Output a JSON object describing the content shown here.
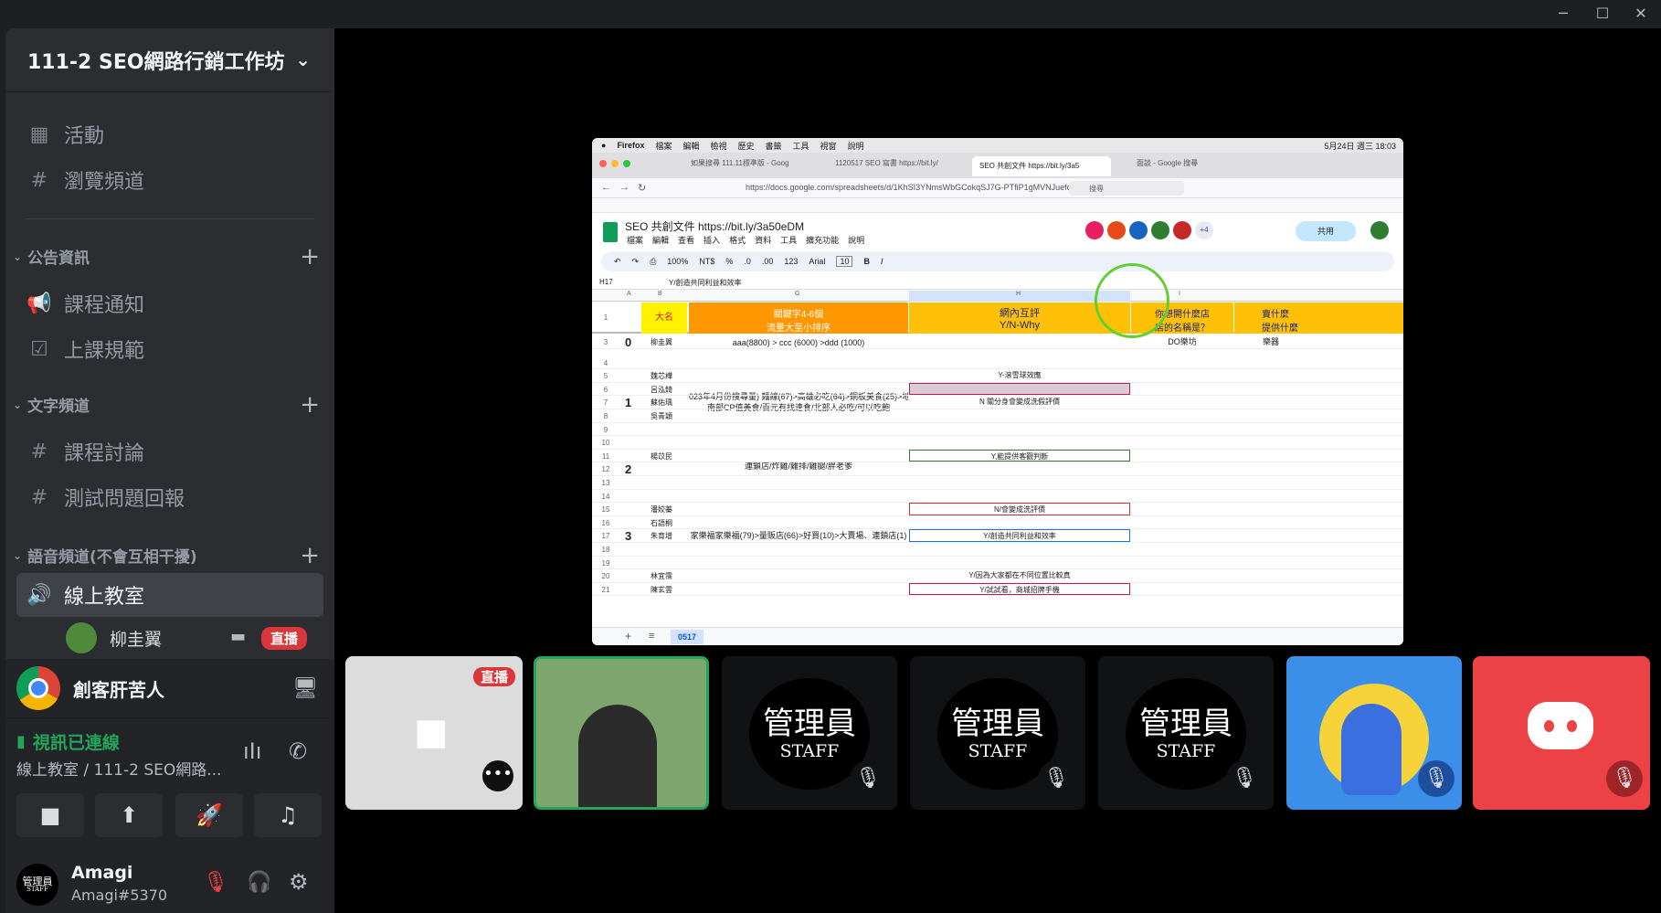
{
  "server": {
    "name": "111-2 SEO網路行銷工作坊"
  },
  "nav": {
    "events": "活動",
    "browse": "瀏覽頻道"
  },
  "categories": {
    "announce": "公告資訊",
    "text": "文字頻道",
    "voice": "語音頻道(不會互相干擾)"
  },
  "channels": {
    "course_notice": "課程通知",
    "class_rules": "上課規範",
    "course_discussion": "課程討論",
    "test_report": "測試問題回報",
    "voice_room": "線上教室"
  },
  "voice_user": {
    "name": "柳圭翼",
    "badge": "直播"
  },
  "activity": {
    "name": "創客肝苦人"
  },
  "connection": {
    "status": "視訊已連線",
    "location": "線上教室 / 111-2 SEO網路..."
  },
  "user": {
    "name": "Amagi",
    "tag": "Amagi#5370"
  },
  "avatar": {
    "line1": "管理員",
    "line2": "STAFF"
  },
  "tiles": {
    "live_badge": "直播",
    "staff_line1": "管理員",
    "staff_line2": "STAFF"
  },
  "screen": {
    "menubar": [
      "Firefox",
      "檔案",
      "編輯",
      "檢視",
      "歷史",
      "書籤",
      "工具",
      "視窗",
      "說明"
    ],
    "clock": "5月24日 週三 18:03",
    "tabs": [
      "如果搜尋 111.11標準版 - Goog",
      "1120517 SEO 寫書 https://bit.ly/",
      "SEO 共創文件 https://bit.ly/3a5",
      "面談 - Google 搜尋"
    ],
    "url": "https://docs.google.com/spreadsheets/d/1KhSI3YNmsWbGCokqSJ7G-PTfiP1gMVNJuefo",
    "search_placeholder": "搜尋",
    "doc_title": "SEO 共創文件 https://bit.ly/3a50eDM",
    "doc_menu": [
      "檔案",
      "編輯",
      "查看",
      "插入",
      "格式",
      "資料",
      "工具",
      "擴充功能",
      "說明"
    ],
    "share": "共用",
    "toolbar": {
      "zoom": "100%",
      "currency": "NT$",
      "percent": "%",
      "dec_down": ".0",
      "dec_up": ".00",
      "num": "123",
      "font": "Arial",
      "size": "10"
    },
    "cell_ref": "H17",
    "formula": "Y/創造共同利益和效率",
    "col_letters": [
      "A",
      "B",
      "G",
      "H",
      "I"
    ],
    "header_row": {
      "b": "大名",
      "g1": "關鍵字4-6個",
      "g2": "流量大至小排序",
      "h1": "網內互評",
      "h2": "Y/N-Why",
      "i1": "你想開什麼店",
      "i2": "店的名稱是？",
      "j1": "賣什麼",
      "j2": "提供什麼"
    },
    "rows": [
      {
        "n": "3",
        "group": "0",
        "name": "柳圭翼",
        "g": "aaa(8800) > ccc (6000) >ddd (1000)",
        "h": "",
        "i": "DO樂坊",
        "j": "樂器"
      },
      {
        "n": "4",
        "name": "",
        "g": "",
        "h": ""
      },
      {
        "n": "5",
        "name": "魏芯樺",
        "h": "Y-滾雪球效應"
      },
      {
        "n": "6",
        "name": "呂泓錡",
        "h": ""
      },
      {
        "n": "7",
        "group": "1",
        "name": "蘇佑瑀",
        "h": "N 關分身會變成洗假評價"
      },
      {
        "n": "8",
        "name": "吳青穎",
        "h": ""
      },
      {
        "n": "9",
        "name": "",
        "h": ""
      },
      {
        "n": "10",
        "name": "",
        "h": ""
      },
      {
        "n": "11",
        "name": "楊苡民",
        "h": "Y,能提供客觀判斷"
      },
      {
        "n": "12",
        "group": "2",
        "name": "",
        "h": ""
      },
      {
        "n": "13",
        "name": "",
        "h": ""
      },
      {
        "n": "14",
        "name": "",
        "h": ""
      },
      {
        "n": "15",
        "name": "潘姣蓁",
        "h": "N/會變成洗評價"
      },
      {
        "n": "16",
        "name": "石語桐",
        "h": ""
      },
      {
        "n": "17",
        "group": "3",
        "name": "朱育增",
        "h": "Y/創造共同利益和效率"
      },
      {
        "n": "18",
        "name": "",
        "h": ""
      },
      {
        "n": "19",
        "name": "",
        "h": ""
      },
      {
        "n": "20",
        "name": "林宜霈",
        "h": "Y/因為大家都在不同位置比較真"
      },
      {
        "n": "21",
        "name": "陳玄雲",
        "h": "Y/試試看，商城招牌手機"
      }
    ],
    "group_keywords": {
      "g1a": "023年4月份搜尋量) 麵線(67)>高雄必吃(64)>銅板美食(25)>地瓜薯條",
      "g1b": "南部CP值美食/百元有找速食/北部人必吃/可以吃飽",
      "g2": "連鎖店/炸雞/雞排/雞腿/胖老爹",
      "g3": "家樂福家樂福(79)>量販店(66)>好買(10)>大賣場、連鎖店(1)"
    },
    "sheet_tab": "0517",
    "avatar_plus": "+4"
  }
}
